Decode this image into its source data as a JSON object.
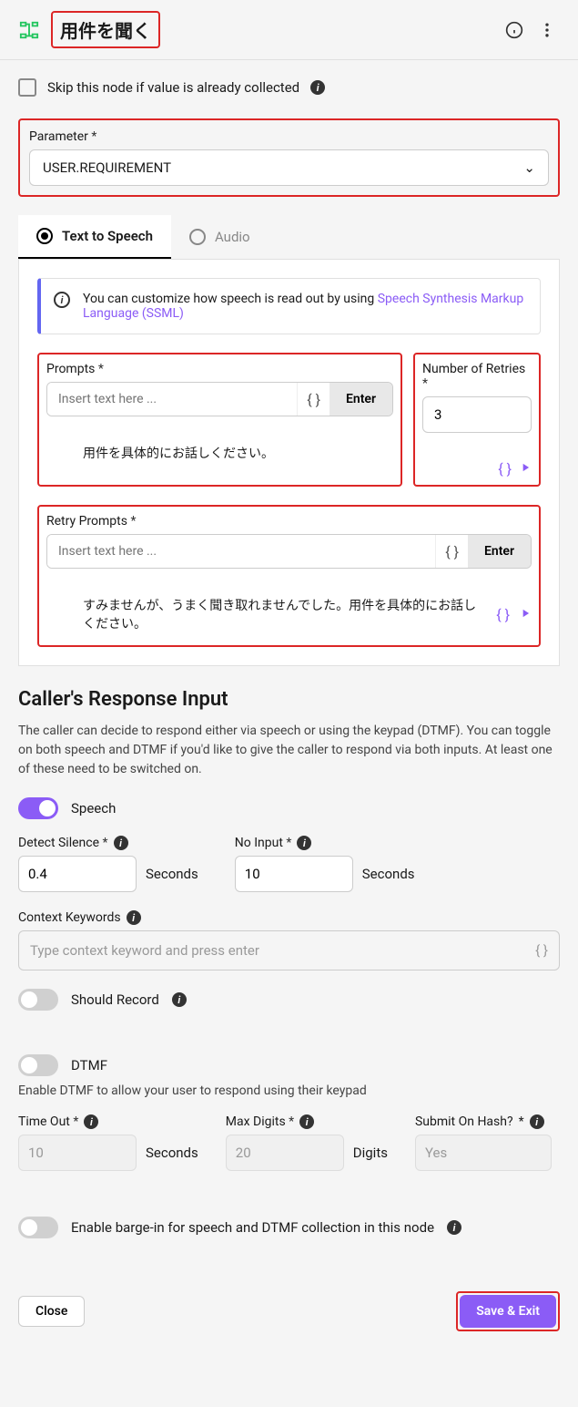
{
  "header": {
    "title": "用件を聞く"
  },
  "skip": {
    "label": "Skip this node if value is already collected"
  },
  "parameter": {
    "label": "Parameter",
    "value": "USER.REQUIREMENT"
  },
  "tabs": {
    "tts": "Text to Speech",
    "audio": "Audio"
  },
  "banner": {
    "text": "You can customize how speech is read out by using ",
    "link": "Speech Synthesis Markup Language (SSML)"
  },
  "prompts": {
    "label": "Prompts",
    "placeholder": "Insert text here ...",
    "enter": "Enter",
    "items": [
      "用件を具体的にお話しください。"
    ]
  },
  "retries": {
    "label": "Number of Retries",
    "value": "3"
  },
  "retry_prompts": {
    "label": "Retry Prompts",
    "placeholder": "Insert text here ...",
    "enter": "Enter",
    "items": [
      "すみませんが、うまく聞き取れませんでした。用件を具体的にお話しください。"
    ]
  },
  "response": {
    "title": "Caller's Response Input",
    "desc": "The caller can decide to respond either via speech or using the keypad (DTMF). You can toggle on both speech and DTMF if you'd like to give the caller to respond via both inputs. At least one of these need to be switched on.",
    "speech_label": "Speech",
    "detect_silence": {
      "label": "Detect Silence",
      "value": "0.4",
      "unit": "Seconds"
    },
    "no_input": {
      "label": "No Input",
      "value": "10",
      "unit": "Seconds"
    },
    "context": {
      "label": "Context Keywords",
      "placeholder": "Type context keyword and press enter"
    },
    "should_record": "Should Record",
    "dtmf_label": "DTMF",
    "dtmf_desc": "Enable DTMF to allow your user to respond using their keypad",
    "timeout": {
      "label": "Time Out",
      "value": "10",
      "unit": "Seconds"
    },
    "max_digits": {
      "label": "Max Digits",
      "value": "20",
      "unit": "Digits"
    },
    "submit_hash": {
      "label": "Submit On Hash?",
      "value": "Yes"
    },
    "barge_in": "Enable barge-in for speech and DTMF collection in this node"
  },
  "footer": {
    "close": "Close",
    "save": "Save & Exit"
  }
}
